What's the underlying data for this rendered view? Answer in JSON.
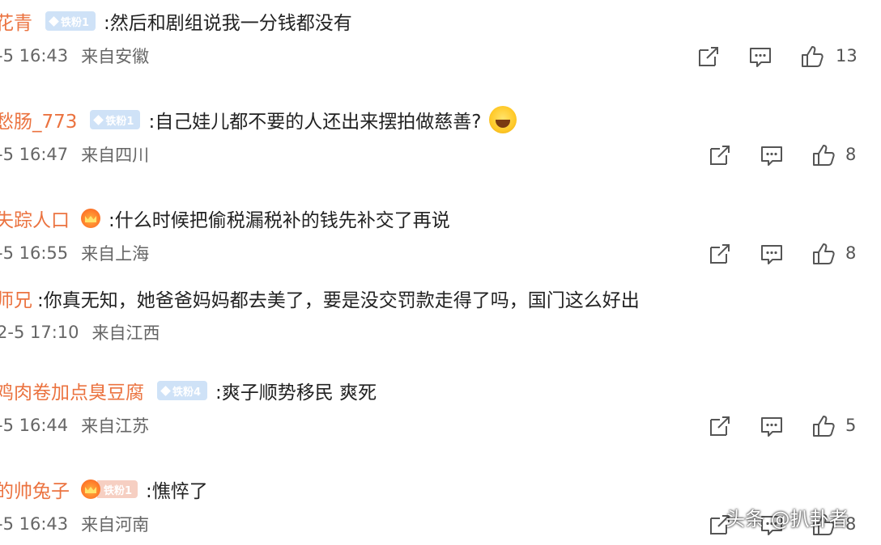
{
  "comments": [
    {
      "user": "花青",
      "badge": {
        "type": "fan",
        "label": "铁粉1"
      },
      "text": ":然后和剧组说我一分钱都没有",
      "time": "-5 16:43",
      "location": "来自安徽",
      "likes": "13"
    },
    {
      "user": "愁肠_773",
      "badge": {
        "type": "fan",
        "label": "铁粉1"
      },
      "text": ":自己娃儿都不要的人还出来摆拍做慈善?",
      "has_emoji": true,
      "emoji_name": "laugh-cry-emoji",
      "time": "-5 16:47",
      "location": "来自四川",
      "likes": "8"
    },
    {
      "user": "失踪人口",
      "badge": {
        "type": "crown",
        "label": ""
      },
      "text": ":什么时候把偷税漏税补的钱先补交了再说",
      "time": "-5 16:55",
      "location": "来自上海",
      "likes": "8"
    },
    {
      "user": "师兄",
      "badge": null,
      "text": ":你真无知，她爸爸妈妈都去美了，要是没交罚款走得了吗，国门这么好出",
      "time": "2-5 17:10",
      "location": "来自江西",
      "likes": null
    },
    {
      "user": "鸡肉卷加点臭豆腐",
      "badge": {
        "type": "fan",
        "label": "铁粉4"
      },
      "text": ":爽子顺势移民 爽死",
      "time": "-5 16:44",
      "location": "来自江苏",
      "likes": "5"
    },
    {
      "user": "的帅兔子",
      "badge": {
        "type": "crown",
        "label": "铁粉1"
      },
      "text": ":憔悴了",
      "time": "-5 16:43",
      "location": "来自河南",
      "likes": "8"
    }
  ],
  "icons": {
    "share": "share-icon",
    "comment": "comment-icon",
    "like": "thumbs-up-icon"
  },
  "colors": {
    "username": "#eb7340",
    "text": "#222222",
    "meta": "#666666",
    "fan_badge": "#cfe2f7"
  },
  "watermark": "头条 @扒卦者"
}
